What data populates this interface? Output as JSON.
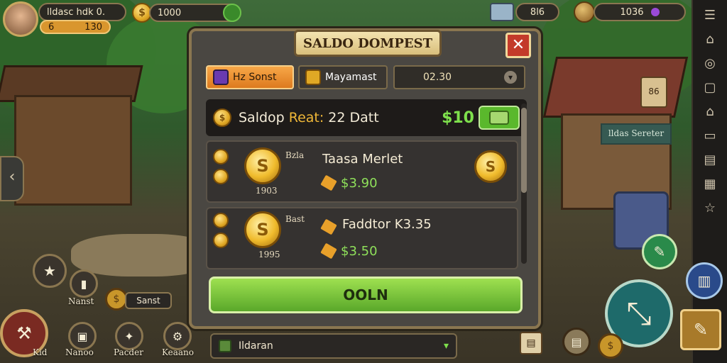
{
  "player": {
    "name": "lldasc hdk 0.",
    "level": "6",
    "level_value": "130"
  },
  "currencies": [
    {
      "icon": "coin-icon",
      "value": "1000"
    },
    {
      "icon": "supply-box-icon",
      "value": "8l6"
    },
    {
      "icon": "gold-nugget-icon",
      "value": "1036"
    }
  ],
  "dialog": {
    "title": "SALDO DOMPEST",
    "close_label": "✕",
    "tabs": [
      {
        "label": "Hz Sonst",
        "active": true
      },
      {
        "label": "Mayamast"
      },
      {
        "label": "02.30"
      }
    ],
    "balance": {
      "label": "Saldop",
      "accent": "Reat:",
      "value": "22 Datt",
      "price": "$10"
    },
    "items": [
      {
        "tag": "Bzla",
        "count": "1903",
        "name": "Taasa Merlet",
        "price": "$3.90"
      },
      {
        "tag": "Bast",
        "count": "1995",
        "name": "Faddtor K3.35",
        "price": "$3.50"
      }
    ],
    "confirm_label": "OOLN"
  },
  "bottom_select": {
    "value": "Ildaran"
  },
  "left_buttons": [
    {
      "label": "Nanst"
    },
    {
      "label": "Sanst"
    },
    {
      "label": "Kid"
    },
    {
      "label": "Nanoo"
    },
    {
      "label": "Pacder"
    },
    {
      "label": "Keaano"
    }
  ],
  "scene_sign": "lldas Sereter",
  "lantern_label": "86",
  "colors": {
    "accent": "#f0b838",
    "confirm": "#7ec83c",
    "close": "#c33a2a"
  }
}
